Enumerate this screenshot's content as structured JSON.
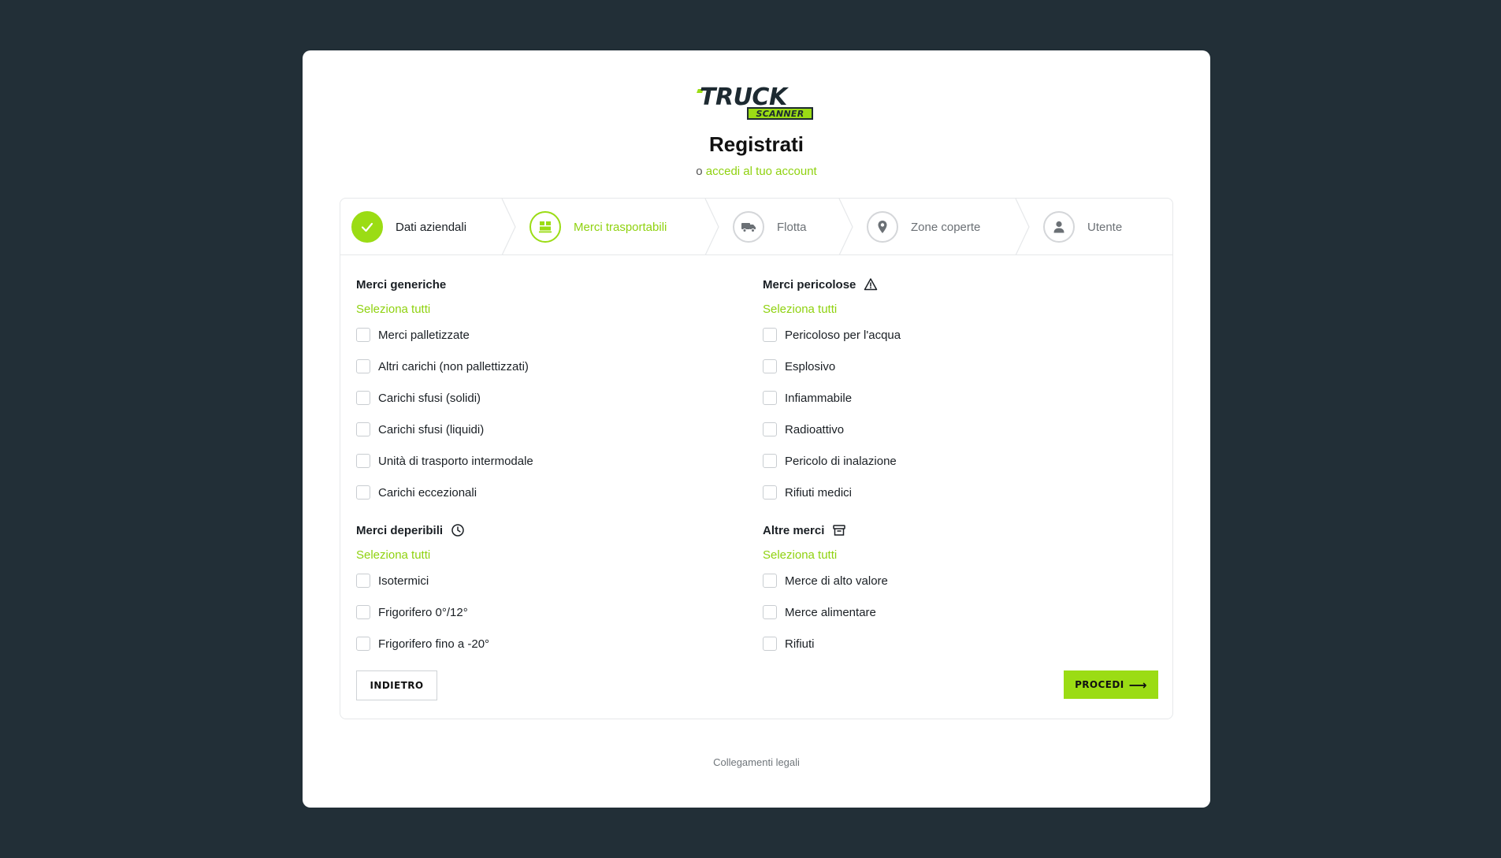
{
  "brand": {
    "logo_main": "TRUCK",
    "logo_sub": "SCANNER",
    "accent": "#9bdc14",
    "background": "#222f37"
  },
  "header": {
    "title": "Registrati",
    "subtitle_prefix": "o",
    "login_link": "accedi al tuo account"
  },
  "steps": [
    {
      "label": "Dati aziendali",
      "state": "done",
      "icon": "check-icon"
    },
    {
      "label": "Merci trasportabili",
      "state": "active",
      "icon": "pallet-icon"
    },
    {
      "label": "Flotta",
      "state": "pending",
      "icon": "truck-icon"
    },
    {
      "label": "Zone coperte",
      "state": "pending",
      "icon": "map-pin-icon"
    },
    {
      "label": "Utente",
      "state": "pending",
      "icon": "user-icon"
    }
  ],
  "groups": {
    "generic": {
      "title": "Merci generiche",
      "select_all": "Seleziona tutti",
      "options": [
        "Merci palletizzate",
        "Altri carichi (non pallettizzati)",
        "Carichi sfusi (solidi)",
        "Carichi sfusi (liquidi)",
        "Unità di trasporto intermodale",
        "Carichi eccezionali"
      ]
    },
    "dangerous": {
      "title": "Merci pericolose",
      "icon": "warning-icon",
      "select_all": "Seleziona tutti",
      "options": [
        "Pericoloso per l'acqua",
        "Esplosivo",
        "Infiammabile",
        "Radioattivo",
        "Pericolo di inalazione",
        "Rifiuti medici"
      ]
    },
    "perishable": {
      "title": "Merci deperibili",
      "icon": "clock-icon",
      "select_all": "Seleziona tutti",
      "options": [
        "Isotermici",
        "Frigorifero 0°/12°",
        "Frigorifero fino a -20°"
      ]
    },
    "other": {
      "title": "Altre merci",
      "icon": "archive-icon",
      "select_all": "Seleziona tutti",
      "options": [
        "Merce di alto valore",
        "Merce alimentare",
        "Rifiuti"
      ]
    }
  },
  "actions": {
    "back_label": "INDIETRO",
    "next_label": "PROCEDI"
  },
  "footer": {
    "legal_link": "Collegamenti legali"
  }
}
